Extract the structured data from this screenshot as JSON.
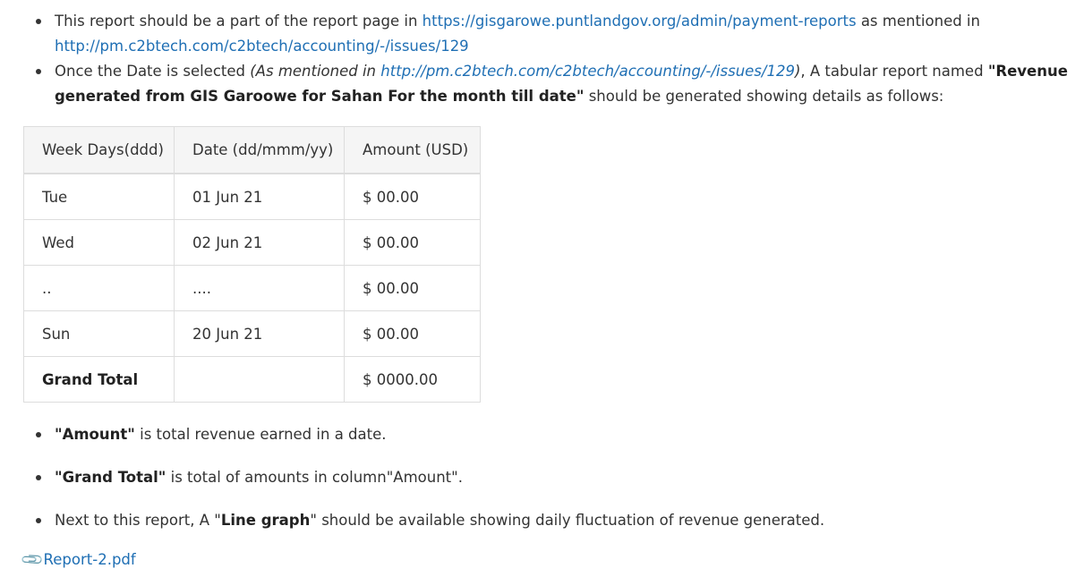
{
  "bullets_top": [
    {
      "pre": "This report should be a part of the report page in ",
      "link1": "https://gisgarowe.puntlandgov.org/admin/payment-reports",
      "mid": " as mentioned in ",
      "link2": "http://pm.c2btech.com/c2btech/accounting/-/issues/129"
    },
    {
      "pre": "Once the Date is selected ",
      "italic_pre": "(As mentioned in ",
      "italic_link": "http://pm.c2btech.com/c2btech/accounting/-/issues/129",
      "italic_post": ")",
      "mid": ", A tabular report named ",
      "bold": "\"Revenue generated from GIS Garoowe for Sahan For the month till date\"",
      "post": " should be generated showing details as follows:"
    }
  ],
  "table": {
    "headers": [
      "Week Days(ddd)",
      "Date (dd/mmm/yy)",
      "Amount (USD)"
    ],
    "rows": [
      [
        "Tue",
        "01 Jun 21",
        "$ 00.00"
      ],
      [
        "Wed",
        "02 Jun 21",
        "$ 00.00"
      ],
      [
        "..",
        "....",
        "$ 00.00"
      ],
      [
        "Sun",
        "20 Jun 21",
        "$ 00.00"
      ],
      [
        "Grand Total",
        "",
        "$ 0000.00"
      ]
    ]
  },
  "bullets_bottom": [
    {
      "bold": "\"Amount\"",
      "post": " is total revenue earned in a date."
    },
    {
      "bold": "\"Grand Total\"",
      "post": " is total of amounts in column\"Amount\"."
    },
    {
      "pre": "Next to this report, A \"",
      "bold": "Line graph",
      "post": "\" should be available showing daily fluctuation of revenue generated."
    }
  ],
  "attachment": {
    "icon": "paperclip-icon",
    "label": "Report-2.pdf"
  }
}
